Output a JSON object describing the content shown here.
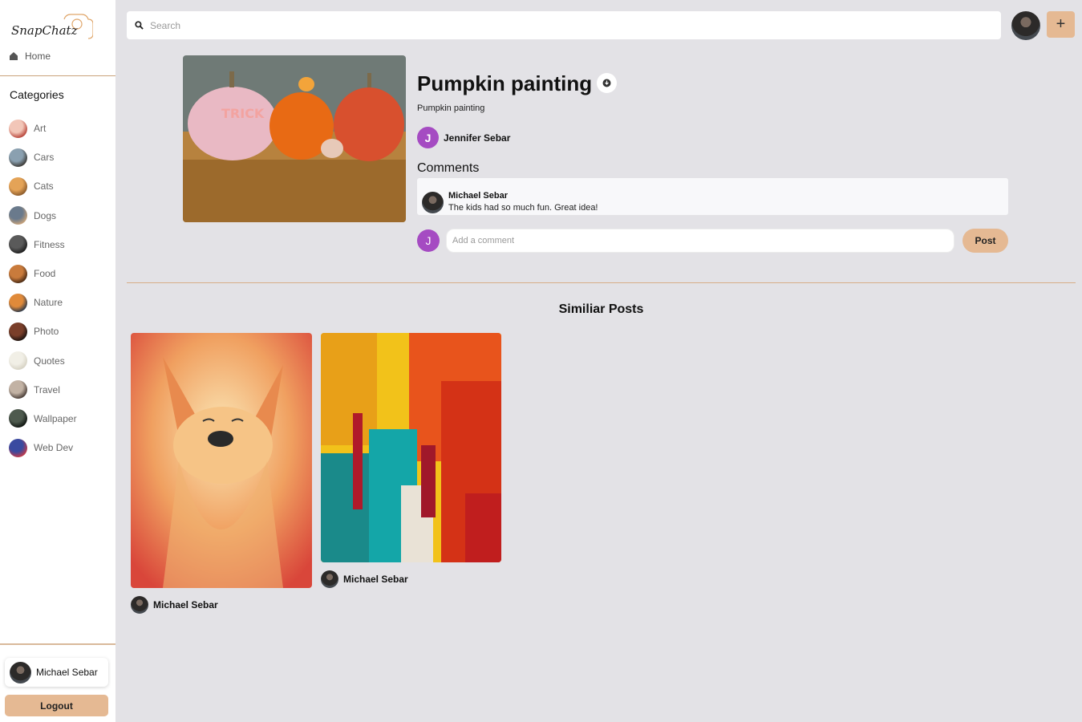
{
  "app": {
    "logo_text": "SnapChatz"
  },
  "sidebar": {
    "home_label": "Home",
    "categories_title": "Categories",
    "categories": [
      {
        "label": "Art",
        "thumb": [
          "#f2c6b8",
          "#b8453a"
        ]
      },
      {
        "label": "Cars",
        "thumb": [
          "#8aa0b0",
          "#3c3a36"
        ]
      },
      {
        "label": "Cats",
        "thumb": [
          "#e4a357",
          "#8b5a2b"
        ]
      },
      {
        "label": "Dogs",
        "thumb": [
          "#6a7a8c",
          "#c9a37a"
        ]
      },
      {
        "label": "Fitness",
        "thumb": [
          "#5a5a5a",
          "#1e1e1e"
        ]
      },
      {
        "label": "Food",
        "thumb": [
          "#c97b3c",
          "#4a2a14"
        ]
      },
      {
        "label": "Nature",
        "thumb": [
          "#e08a3a",
          "#2f3a4a"
        ]
      },
      {
        "label": "Photo",
        "thumb": [
          "#7a3f2a",
          "#1e1410"
        ]
      },
      {
        "label": "Quotes",
        "thumb": [
          "#f1efe6",
          "#d6d2c4"
        ]
      },
      {
        "label": "Travel",
        "thumb": [
          "#c2b2a4",
          "#4a3e38"
        ]
      },
      {
        "label": "Wallpaper",
        "thumb": [
          "#4e5a4e",
          "#0f1410"
        ]
      },
      {
        "label": "Web Dev",
        "thumb": [
          "#3a4aa0",
          "#c23a4a"
        ]
      }
    ],
    "user_name": "Michael Sebar",
    "logout_label": "Logout"
  },
  "header": {
    "search_placeholder": "Search",
    "add_label": "+"
  },
  "post": {
    "title": "Pumpkin painting",
    "description": "Pumpkin painting",
    "author_initial": "J",
    "author_name": "Jennifer Sebar",
    "comments_title": "Comments",
    "comments": [
      {
        "author": "Michael Sebar",
        "text": "The kids had so much fun. Great idea!"
      }
    ],
    "comment_avatar_initial": "J",
    "comment_placeholder": "Add a comment",
    "post_button_label": "Post"
  },
  "similar": {
    "title": "Similiar Posts",
    "posts": [
      {
        "author": "Michael Sebar",
        "image": "watercolor-fox"
      },
      {
        "author": "Michael Sebar",
        "image": "abstract-paint"
      }
    ]
  },
  "colors": {
    "accent": "#e5b993",
    "divider": "#d7ad86",
    "avatar_j": "#a54bc2",
    "background": "#e3e2e6"
  }
}
